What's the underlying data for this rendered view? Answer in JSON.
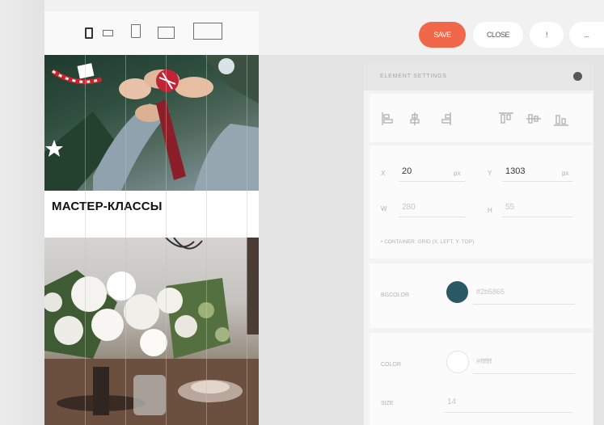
{
  "toolbar": {
    "save_label": "SAVE",
    "close_label": "CLOSE",
    "info_label": "!",
    "more_label": "..."
  },
  "preview": {
    "section_title": "МАСТЕР-КЛАССЫ"
  },
  "panel": {
    "title": "ELEMENT SETTINGS",
    "position": {
      "x_label": "X",
      "x_value": "20",
      "x_unit": "px",
      "y_label": "Y",
      "y_value": "1303",
      "y_unit": "px",
      "w_label": "W",
      "w_value": "280",
      "h_label": "H",
      "h_value": "55",
      "container_note": "• CONTAINER: GRID (X: LEFT, Y: TOP)"
    },
    "bgcolor": {
      "label": "BGCOLOR",
      "value": "#2b5865",
      "swatch": "#2b5865"
    },
    "text": {
      "color_label": "COLOR",
      "color_value": "#ffffff",
      "swatch": "#ffffff",
      "size_label": "SIZE",
      "size_value": "14"
    }
  },
  "colors": {
    "save": "#f0674a",
    "panel": "#f3f3f3",
    "canvas": "#e4e4e4"
  }
}
